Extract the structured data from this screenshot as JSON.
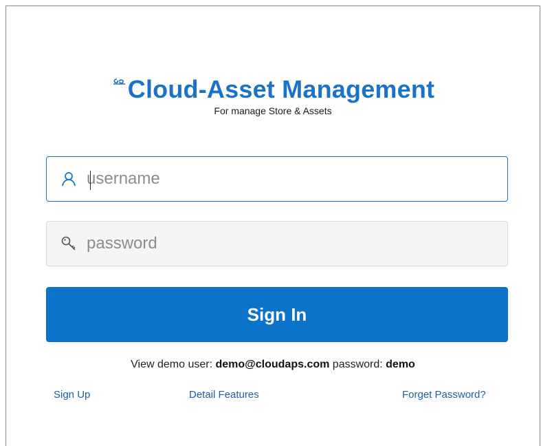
{
  "brand": {
    "title": "Cloud-Asset Management",
    "subtitle": "For manage Store & Assets",
    "logo_icon": "cloud-link-icon",
    "accent_color": "#1a73c8"
  },
  "login": {
    "username_placeholder": "username",
    "username_value": "",
    "password_placeholder": "password",
    "password_value": "",
    "username_icon": "user-icon",
    "password_icon": "key-icon",
    "signin_label": "Sign In",
    "button_color": "#0b73c9"
  },
  "demo": {
    "prefix": "View demo  user: ",
    "user": "demo@cloudaps.com",
    "password_label": " password: ",
    "password": "demo"
  },
  "links": {
    "sign_up": "Sign Up",
    "detail_features": "Detail Features",
    "forget_password": "Forget Password?"
  }
}
